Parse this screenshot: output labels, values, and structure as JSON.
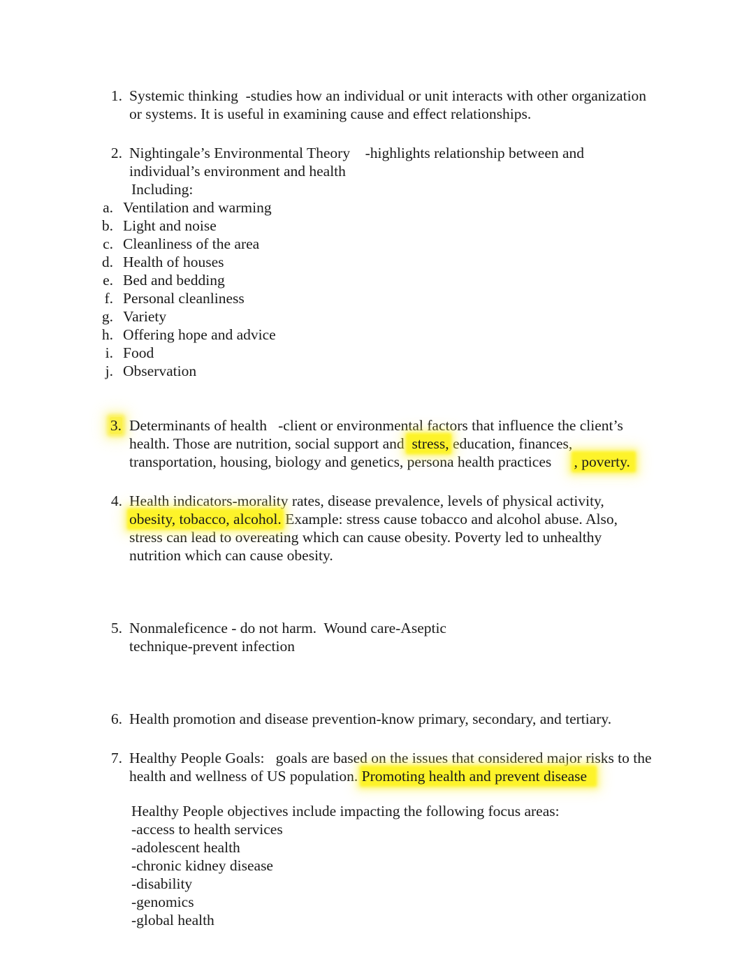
{
  "document": {
    "items": [
      {
        "marker": "1.",
        "text": "Systemic thinking  -studies how an individual or unit interacts with other organization or systems. It is useful in examining cause and effect relationships."
      },
      {
        "marker": "2.",
        "text": "Nightingale’s Environmental Theory    -highlights relationship between and individual’s environment and health"
      }
    ],
    "including_label": "Including:",
    "alpha_items": [
      {
        "marker": "a.",
        "text": "Ventilation and warming"
      },
      {
        "marker": "b.",
        "text": "Light and noise"
      },
      {
        "marker": "c.",
        "text": "Cleanliness of the area"
      },
      {
        "marker": "d.",
        "text": "Health of houses"
      },
      {
        "marker": "e.",
        "text": "Bed and bedding"
      },
      {
        "marker": "f.",
        "text": "Personal cleanliness"
      },
      {
        "marker": "g.",
        "text": "Variety"
      },
      {
        "marker": "h.",
        "text": "Offering hope and advice"
      },
      {
        "marker": "i.",
        "text": "Food"
      },
      {
        "marker": "j.",
        "text": "Observation"
      }
    ],
    "item3": {
      "marker": "3.",
      "marker_highlighted": true,
      "part1": "Determinants of health   -client or environmental factors that influence the client’s health. Those are nutrition, social support and ",
      "highlight1": " stress,",
      "part2": " education, finances, transportation, housing, biology and genetics, persona health practices      ",
      "highlight2": ", poverty. "
    },
    "item4": {
      "marker": "4.",
      "part1": "Health indicators-morality rates, disease prevalence, levels of physical activity, ",
      "highlight1": "obesity, tobacco, alcohol.",
      "part2": " Example: stress cause tobacco and alcohol abuse. Also, stress can lead to overeating which can cause obesity. Poverty led to unhealthy nutrition which can cause obesity."
    },
    "item5": {
      "marker": "5.",
      "text": "Nonmaleficence - do not harm.  Wound care-Aseptic technique-prevent infection"
    },
    "item6": {
      "marker": "6.",
      "text": "Health promotion and disease prevention-know primary, secondary, and tertiary."
    },
    "item7": {
      "marker": "7.",
      "part1": "Healthy People Goals:   goals are based on the issues that considered major risks to the health and wellness of US population. ",
      "highlight1": "Promoting health and prevent disease  "
    },
    "objectives_intro": "Healthy People objectives include impacting the following focus areas:",
    "focus_areas": [
      "-access to health services",
      "-adolescent health",
      "-chronic kidney disease",
      "-disability",
      "-genomics",
      "-global health"
    ],
    "colors": {
      "highlight": "#fdf32a",
      "text": "#1a1a1a",
      "background": "#ffffff"
    }
  }
}
